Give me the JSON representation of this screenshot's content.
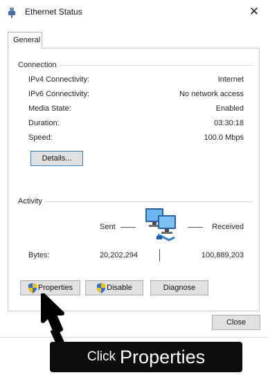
{
  "window": {
    "title": "Ethernet Status",
    "close_glyph": "✕"
  },
  "tabs": [
    {
      "label": "General"
    }
  ],
  "connection": {
    "group_label": "Connection",
    "rows": [
      {
        "label": "IPv4 Connectivity:",
        "value": "Internet"
      },
      {
        "label": "IPv6 Connectivity:",
        "value": "No network access"
      },
      {
        "label": "Media State:",
        "value": "Enabled"
      },
      {
        "label": "Duration:",
        "value": "03:30:18"
      },
      {
        "label": "Speed:",
        "value": "100.0 Mbps"
      }
    ],
    "details_button": "Details..."
  },
  "activity": {
    "group_label": "Activity",
    "sent_label": "Sent",
    "received_label": "Received",
    "bytes_label": "Bytes:",
    "bytes_sent": "20,202,294",
    "bytes_received": "100,889,203",
    "icon": "network-computers-icon"
  },
  "buttons": {
    "properties": "Properties",
    "disable": "Disable",
    "diagnose": "Diagnose",
    "close": "Close"
  },
  "annotation": {
    "text_small": "Click",
    "text_big": "Properties",
    "arrow_icon": "pointer-arrow-icon"
  },
  "colors": {
    "shield_blue": "#2f6fd6",
    "shield_yellow": "#f5c400",
    "focus_border": "#3c7fb1",
    "callout_bg": "#0d0d0d"
  }
}
